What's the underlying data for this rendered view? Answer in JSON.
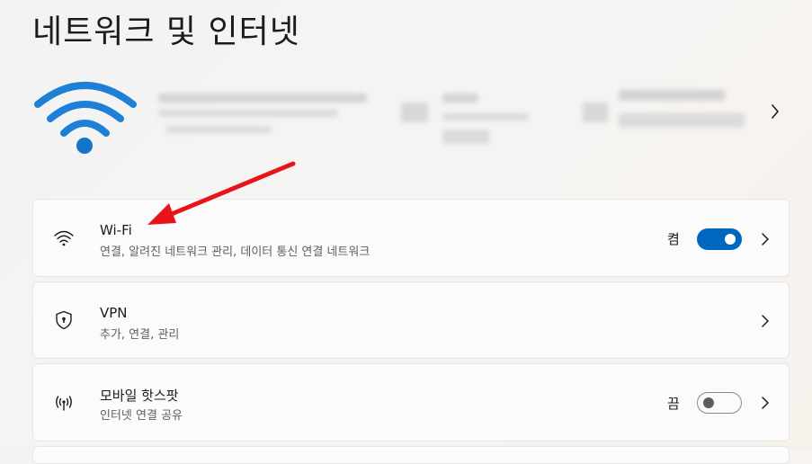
{
  "page": {
    "title": "네트워크 및 인터넷"
  },
  "hero": {
    "icon": "wifi-large-icon",
    "chevron_icon": "chevron-right-icon"
  },
  "cards": [
    {
      "title": "Wi-Fi",
      "subtitle": "연결, 알려진 네트워크 관리, 데이터 통신 연결 네트워크",
      "icon": "wifi-icon",
      "state_label": "켬",
      "toggle_on": true
    },
    {
      "title": "VPN",
      "subtitle": "추가, 연결, 관리",
      "icon": "vpn-shield-icon"
    },
    {
      "title": "모바일 핫스팟",
      "subtitle": "인터넷 연결 공유",
      "icon": "hotspot-icon",
      "state_label": "끔",
      "toggle_on": false
    }
  ],
  "colors": {
    "accent": "#0067c0",
    "annotation_arrow": "#e8141b"
  }
}
